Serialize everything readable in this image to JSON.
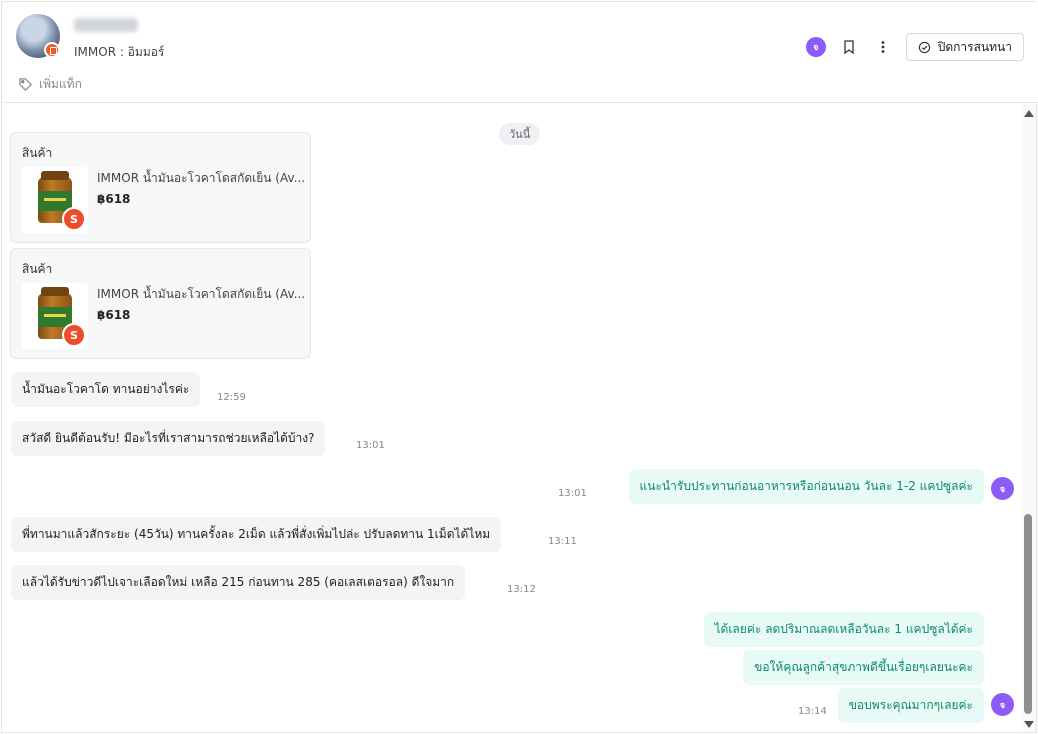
{
  "header": {
    "shop_name": "IMMOR : อิมมอร์",
    "add_tag_label": "เพิ่มแท็ก",
    "agent_initial": "จ",
    "close_chat_label": "ปิดการสนทนา"
  },
  "chat": {
    "date_label": "วันนี้",
    "product_cards": [
      {
        "title": "สินค้า",
        "name": "IMMOR น้ำมันอะโวคาโดสกัดเย็น (Av...",
        "price": "฿618",
        "badge": "S"
      },
      {
        "title": "สินค้า",
        "name": "IMMOR น้ำมันอะโวคาโดสกัดเย็น (Av...",
        "price": "฿618",
        "badge": "S"
      }
    ],
    "messages": [
      {
        "side": "in",
        "text": "น้ำมันอะโวคาโด ทานอย่างไรค่ะ",
        "time": "12:59"
      },
      {
        "side": "in",
        "text": "สวัสดี ยินดีต้อนรับ! มีอะไรที่เราสามารถช่วยเหลือได้บ้าง?",
        "time": "13:01"
      },
      {
        "side": "out",
        "text": "แนะนำรับประทานก่อนอาหารหรือก่อนนอน วันละ 1-2 แคปซูลค่ะ",
        "time": "13:01",
        "avatar": "จ"
      },
      {
        "side": "in",
        "text": "พี่ทานมาแล้วสักระยะ (45วัน) ทานครั้งละ 2เม็ด แล้วพี่สั่งเพิ่มไปล่ะ ปรับลดทาน 1เม็ดได้ไหม",
        "time": "13:11"
      },
      {
        "side": "in",
        "text": "แล้วได้รับข่าวดีไปเจาะเลือดใหม่ เหลือ 215 ก่อนทาน 285 (คอเลสเตอรอล) ดีใจมาก",
        "time": "13:12"
      },
      {
        "side": "out",
        "text": "ได้เลยค่ะ ลดปริมาณลดเหลือวันละ 1 แคปซูลได้ค่ะ"
      },
      {
        "side": "out",
        "text": "ขอให้คุณลูกค้าสุขภาพดีขึ้นเรื่อยๆเลยนะคะ"
      },
      {
        "side": "out",
        "text": "ขอบพระคุณมากๆเลยค่ะ",
        "time": "13:14",
        "avatar": "จ"
      }
    ]
  },
  "colors": {
    "agent_purple": "#8b5cf6",
    "outgoing_text": "#0f8a6a",
    "outgoing_bg": "#e7faf5",
    "shopee_orange": "#ee4d2d"
  },
  "icons": [
    "tag-icon",
    "bookmark-icon",
    "more-vertical-icon",
    "check-circle-icon",
    "shopee-bag-icon"
  ]
}
